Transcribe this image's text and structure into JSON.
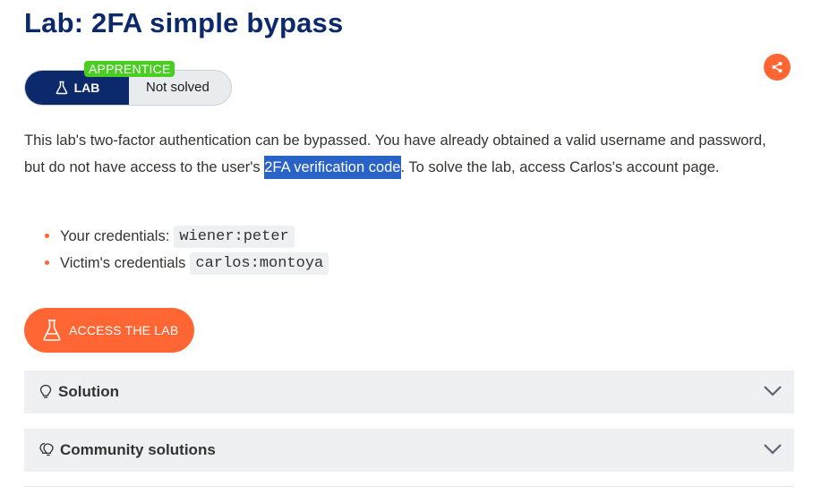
{
  "page": {
    "title": "Lab: 2FA simple bypass"
  },
  "status_widget": {
    "level": "APPRENTICE",
    "lab_label": "LAB",
    "status": "Not solved"
  },
  "description": {
    "part1": "This lab's two-factor authentication can be bypassed. You have already obtained a valid username and password, but do not have access to the user's ",
    "highlight": "2FA verification code",
    "part2": ". To solve the lab, access Carlos's account page."
  },
  "credentials": [
    {
      "label": "Your credentials:",
      "code": "wiener:peter"
    },
    {
      "label": "Victim's credentials",
      "code": "carlos:montoya"
    }
  ],
  "access_button": {
    "label": "ACCESS THE LAB"
  },
  "accordions": [
    {
      "label": "Solution"
    },
    {
      "label": "Community solutions"
    }
  ],
  "icons": {
    "share": "share-icon",
    "flask": "flask-icon",
    "bulb": "lightbulb-icon",
    "bulbs": "lightbulbs-icon",
    "chevron": "chevron-down-icon"
  },
  "colors": {
    "title": "#0c2a6b",
    "accent": "#ff6633",
    "badge": "#4bce23",
    "highlight": "#2a63c8"
  }
}
